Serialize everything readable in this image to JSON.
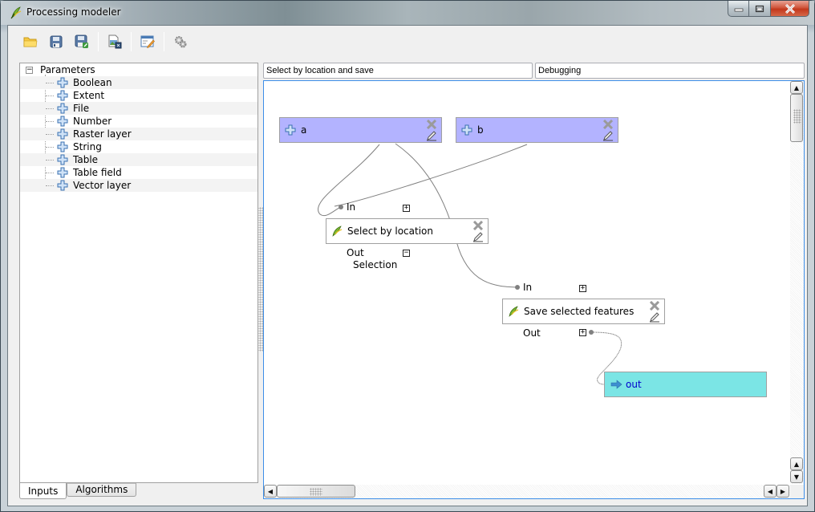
{
  "window": {
    "title": "Processing modeler",
    "buttons": {
      "minimize": "minimize",
      "maximize": "maximize",
      "close": "close"
    }
  },
  "toolbar": {
    "buttons": [
      {
        "name": "open-model-button",
        "icon": "folder-open-icon"
      },
      {
        "name": "save-model-button",
        "icon": "save-icon"
      },
      {
        "name": "save-as-model-button",
        "icon": "save-as-icon"
      },
      {
        "name": "export-image-button",
        "icon": "export-image-icon"
      },
      {
        "name": "edit-help-button",
        "icon": "edit-help-icon"
      },
      {
        "name": "run-model-button",
        "icon": "gears-icon"
      }
    ]
  },
  "inputs_tree": {
    "root": "Parameters",
    "items": [
      "Boolean",
      "Extent",
      "File",
      "Number",
      "Raster layer",
      "String",
      "Table",
      "Table field",
      "Vector layer"
    ]
  },
  "tabs": {
    "inputs": "Inputs",
    "algorithms": "Algorithms",
    "active": "Inputs"
  },
  "model": {
    "name": "Select by location and save",
    "group": "Debugging"
  },
  "canvas": {
    "params": [
      {
        "label": "a"
      },
      {
        "label": "b"
      }
    ],
    "algorithms": [
      {
        "label": "Select by location",
        "input": "In",
        "input_toggle": "+",
        "output": "Out",
        "output_toggle": "−",
        "output_detail": "Selection"
      },
      {
        "label": "Save selected features",
        "input": "In",
        "input_toggle": "+",
        "output": "Out",
        "output_toggle": "+"
      }
    ],
    "outputs": [
      {
        "label": "out"
      }
    ],
    "colors": {
      "param": "#b3b3ff",
      "algorithm": "#ffffff",
      "output": "#7be5e5",
      "link": "#808080"
    }
  }
}
